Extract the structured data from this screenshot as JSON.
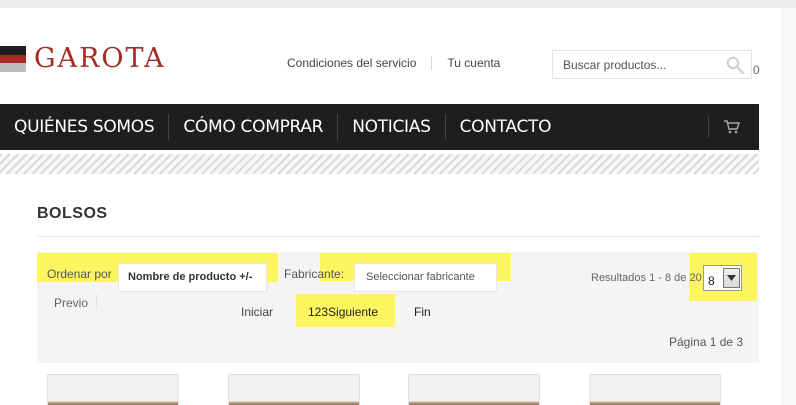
{
  "logo": {
    "text": "GAROTA",
    "flag_colors": [
      "#1e1e1e",
      "#a52a22",
      "#bcbcbc"
    ]
  },
  "header": {
    "links": [
      "Condiciones del servicio",
      "Tu cuenta"
    ],
    "search_placeholder": "Buscar productos...",
    "cart_count": "0"
  },
  "nav": {
    "items": [
      "QUIÉNES SOMOS",
      "CÓMO COMPRAR",
      "NOTICIAS",
      "CONTACTO"
    ],
    "cart_icon": "shopping-cart-icon"
  },
  "page": {
    "title": "BOLSOS"
  },
  "filters": {
    "order_label": "Ordenar por",
    "order_value": "Nombre de producto +/-",
    "manufacturer_label": "Fabricante:",
    "manufacturer_value": "Seleccionar fabricante",
    "results_text": "Resultados 1 - 8 de 20",
    "limit_value": "8"
  },
  "pagination": {
    "prev": "Previo",
    "start": "Iniciar",
    "pages_next": "123Siguiente",
    "end": "Fin",
    "page_info": "Página 1 de 3"
  },
  "colors": {
    "accent": "#a52a22",
    "nav_bg": "#1e1e1e",
    "highlight": "#fcf55f"
  }
}
